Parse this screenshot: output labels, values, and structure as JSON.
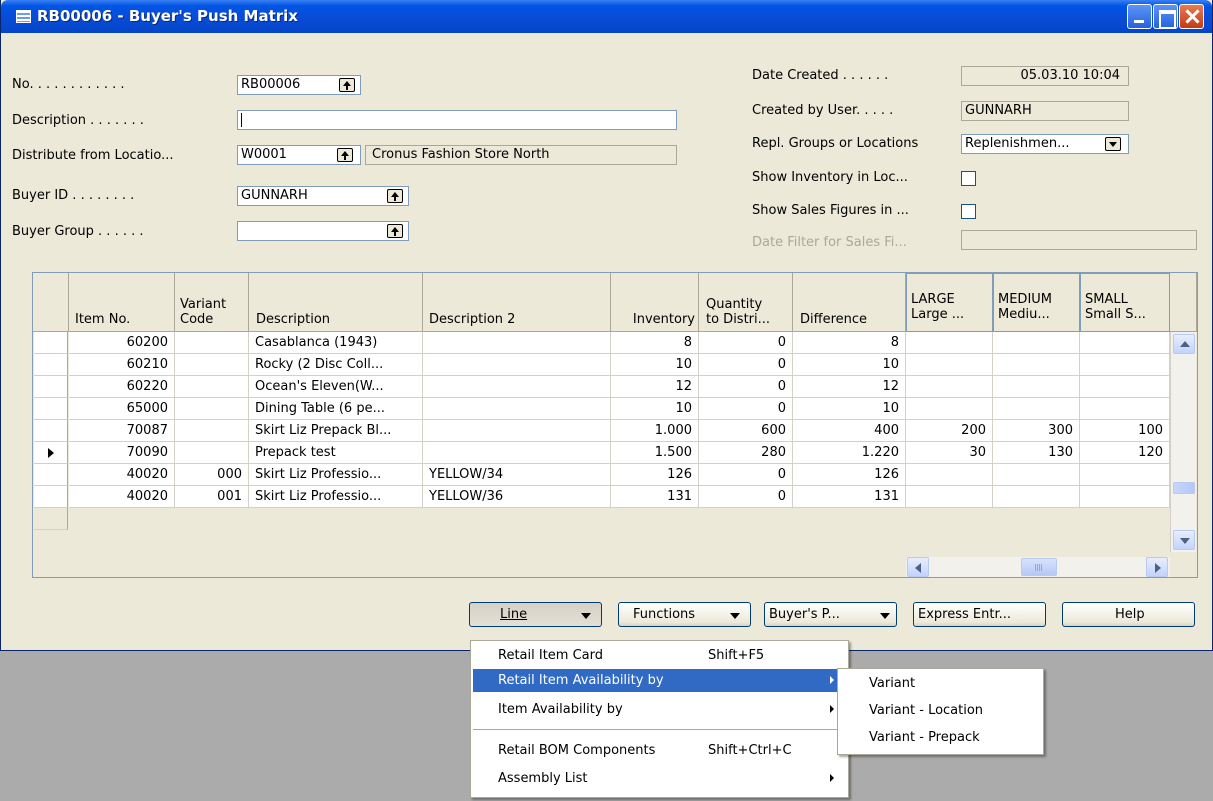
{
  "window": {
    "title": "RB00006 - Buyer's Push Matrix"
  },
  "form": {
    "no": {
      "label": "No. . . . . . . . . . . .",
      "value": "RB00006"
    },
    "description": {
      "label": "Description . . . . . . .",
      "value": ""
    },
    "distribute_from": {
      "label": "Distribute from Locatio...",
      "value": "W0001",
      "name": "Cronus Fashion Store North"
    },
    "buyer_id": {
      "label": "Buyer ID . . . . . . . .",
      "value": "GUNNARH"
    },
    "buyer_group": {
      "label": "Buyer Group . . . . . .",
      "value": ""
    },
    "date_created": {
      "label": "Date Created . . . . . .",
      "value": "05.03.10 10:04"
    },
    "created_by": {
      "label": "Created by User. . . . .",
      "value": "GUNNARH"
    },
    "repl_groups": {
      "label": "Repl. Groups or Locations",
      "value": "Replenishmen..."
    },
    "show_inventory": {
      "label": "Show Inventory in Loc...",
      "checked": false
    },
    "show_sales": {
      "label": "Show Sales Figures in ...",
      "checked": false
    },
    "date_filter": {
      "label": "Date Filter for Sales Fi...",
      "value": ""
    }
  },
  "grid": {
    "headers": {
      "item_no": "Item No.",
      "variant_code": "Variant\nCode",
      "description": "Description",
      "description2": "Description 2",
      "inventory": "Inventory",
      "qty_to_distribute": "Quantity\nto Distri...",
      "difference": "Difference",
      "large": "LARGE\nLarge ...",
      "medium": "MEDIUM\nMediu...",
      "small": "SMALL\nSmall S..."
    },
    "rows": [
      {
        "item_no": "60200",
        "variant": "",
        "description": "Casablanca (1943)",
        "description2": "",
        "inventory": "8",
        "qty": "0",
        "difference": "8",
        "large": "",
        "medium": "",
        "small": "",
        "current": false
      },
      {
        "item_no": "60210",
        "variant": "",
        "description": "Rocky (2 Disc Coll...",
        "description2": "",
        "inventory": "10",
        "qty": "0",
        "difference": "10",
        "large": "",
        "medium": "",
        "small": "",
        "current": false
      },
      {
        "item_no": "60220",
        "variant": "",
        "description": "Ocean's Eleven(W...",
        "description2": "",
        "inventory": "12",
        "qty": "0",
        "difference": "12",
        "large": "",
        "medium": "",
        "small": "",
        "current": false
      },
      {
        "item_no": "65000",
        "variant": "",
        "description": "Dining Table (6 pe...",
        "description2": "",
        "inventory": "10",
        "qty": "0",
        "difference": "10",
        "large": "",
        "medium": "",
        "small": "",
        "current": false
      },
      {
        "item_no": "70087",
        "variant": "",
        "description": "Skirt Liz Prepack Bl...",
        "description2": "",
        "inventory": "1.000",
        "qty": "600",
        "difference": "400",
        "large": "200",
        "medium": "300",
        "small": "100",
        "current": false
      },
      {
        "item_no": "70090",
        "variant": "",
        "description": "Prepack test",
        "description2": "",
        "inventory": "1.500",
        "qty": "280",
        "difference": "1.220",
        "large": "30",
        "medium": "130",
        "small": "120",
        "current": true
      },
      {
        "item_no": "40020",
        "variant": "000",
        "description": "Skirt Liz Professio...",
        "description2": "YELLOW/34",
        "inventory": "126",
        "qty": "0",
        "difference": "126",
        "large": "",
        "medium": "",
        "small": "",
        "current": false
      },
      {
        "item_no": "40020",
        "variant": "001",
        "description": "Skirt Liz Professio...",
        "description2": "YELLOW/36",
        "inventory": "131",
        "qty": "0",
        "difference": "131",
        "large": "",
        "medium": "",
        "small": "",
        "current": false
      }
    ]
  },
  "buttons": {
    "line": "Line",
    "functions": "Functions",
    "buyers_push": "Buyer's P...",
    "express_entry": "Express Entr...",
    "help": "Help"
  },
  "line_menu": {
    "items": [
      {
        "label": "Retail Item Card",
        "shortcut": "Shift+F5"
      },
      {
        "label": "Retail Item Availability by",
        "shortcut": ""
      },
      {
        "label": "Item Availability by",
        "shortcut": ""
      },
      {
        "label": "Retail BOM Components",
        "shortcut": "Shift+Ctrl+C"
      },
      {
        "label": "Assembly List",
        "shortcut": ""
      }
    ]
  },
  "submenu": {
    "items": [
      "Variant",
      "Variant - Location",
      "Variant - Prepack"
    ]
  },
  "colors": {
    "titlebar": "#0055e5",
    "window_bg": "#ece9d8",
    "menu_highlight": "#316ac5",
    "desktop": "#ababab"
  }
}
